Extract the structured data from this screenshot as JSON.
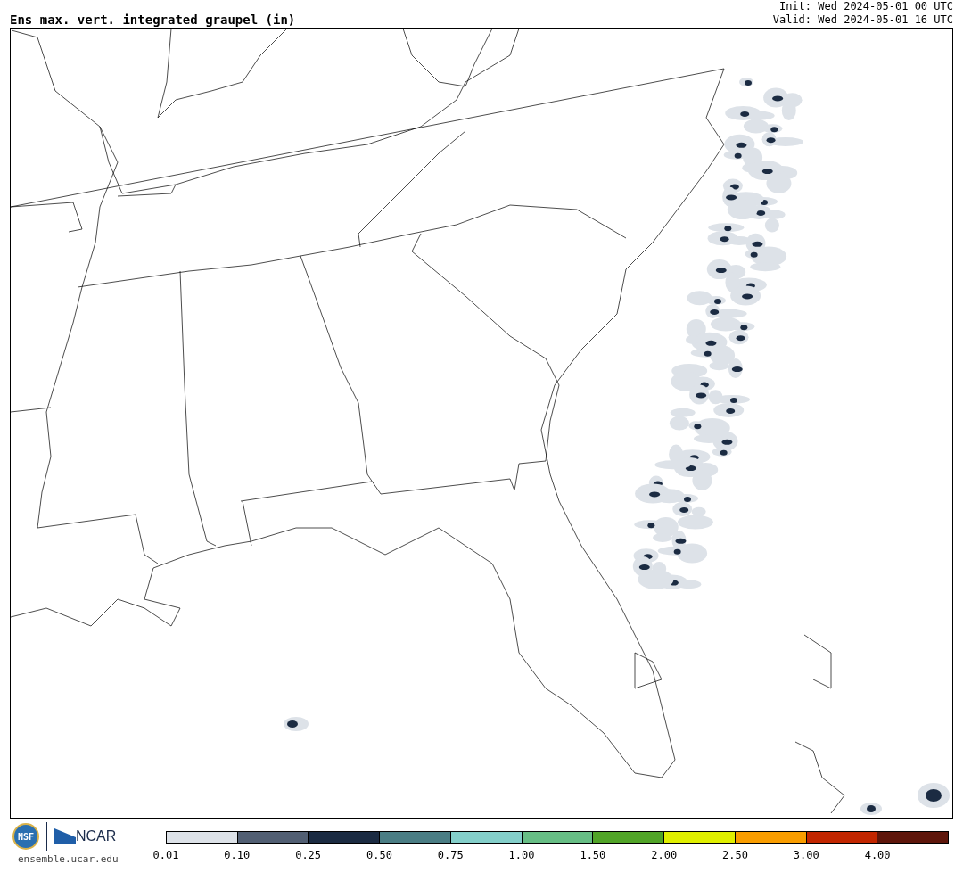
{
  "title": "Ens max. vert. integrated graupel (in)",
  "init": "Init: Wed 2024-05-01 00 UTC",
  "valid": "Valid: Wed 2024-05-01 16 UTC",
  "logos": {
    "nsf": "NSF",
    "ncar": "NCAR",
    "url": "ensemble.ucar.edu"
  },
  "colorbar": [
    {
      "label": "0.01",
      "color": "#dde2e8"
    },
    {
      "label": "0.10",
      "color": "#525f73"
    },
    {
      "label": "0.25",
      "color": "#1b2b42"
    },
    {
      "label": "0.50",
      "color": "#4a7d84"
    },
    {
      "label": "0.75",
      "color": "#84cfca"
    },
    {
      "label": "1.00",
      "color": "#67be85"
    },
    {
      "label": "1.50",
      "color": "#51a428"
    },
    {
      "label": "2.00",
      "color": "#e0ef00"
    },
    {
      "label": "2.50",
      "color": "#f99d00"
    },
    {
      "label": "3.00",
      "color": "#c22600"
    },
    {
      "label": "4.00",
      "color": "#5e160b"
    }
  ]
}
